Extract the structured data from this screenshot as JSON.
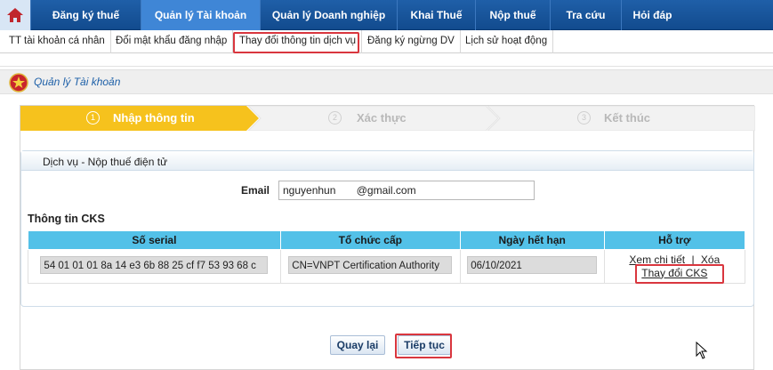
{
  "topnav": {
    "home_icon": "home-icon",
    "items": [
      {
        "label": "Đăng ký thuế"
      },
      {
        "label": "Quản lý Tài khoản",
        "active": true
      },
      {
        "label": "Quản lý Doanh nghiệp"
      },
      {
        "label": "Khai Thuế"
      },
      {
        "label": "Nộp thuế"
      },
      {
        "label": "Tra cứu"
      },
      {
        "label": "Hỏi đáp"
      }
    ]
  },
  "subnav": {
    "items": [
      {
        "label": "TT tài khoản cá nhân"
      },
      {
        "label": "Đổi mật khẩu đăng nhập"
      },
      {
        "label": "Thay đổi thông tin dịch vụ",
        "highlighted": true
      },
      {
        "label": "Đăng ký ngừng DV"
      },
      {
        "label": "Lịch sử hoạt động"
      }
    ]
  },
  "section": {
    "title": "Quản lý Tài khoản",
    "emblem_icon": "emblem-icon"
  },
  "wizard": {
    "steps": [
      {
        "num": "1",
        "label": "Nhập thông tin",
        "active": true
      },
      {
        "num": "2",
        "label": "Xác thực"
      },
      {
        "num": "3",
        "label": "Kết thúc"
      }
    ]
  },
  "service": {
    "title": "Dịch vụ - Nộp thuế điện tử",
    "email_label": "Email",
    "email_value": "nguyenhun       @gmail.com"
  },
  "cks": {
    "title": "Thông tin CKS",
    "headers": [
      "Số serial",
      "Tổ chức cấp",
      "Ngày hết hạn",
      "Hỗ trợ"
    ],
    "row": {
      "serial": "54 01 01 01 8a 14 e3 6b 88 25 cf f7 53 93 68 c",
      "issuer": "CN=VNPT Certification Authority",
      "expiry": "06/10/2021",
      "view_link": "Xem chi tiết",
      "separator": "|",
      "delete_link": "Xóa",
      "change_link": "Thay đổi CKS"
    }
  },
  "buttons": {
    "back": "Quay lại",
    "next": "Tiếp tục"
  },
  "colors": {
    "nav_bg": "#1a56a0",
    "nav_active": "#3f86d6",
    "step_active": "#f6c21d",
    "table_header": "#53c1e8",
    "highlight_red": "#d9363e"
  }
}
